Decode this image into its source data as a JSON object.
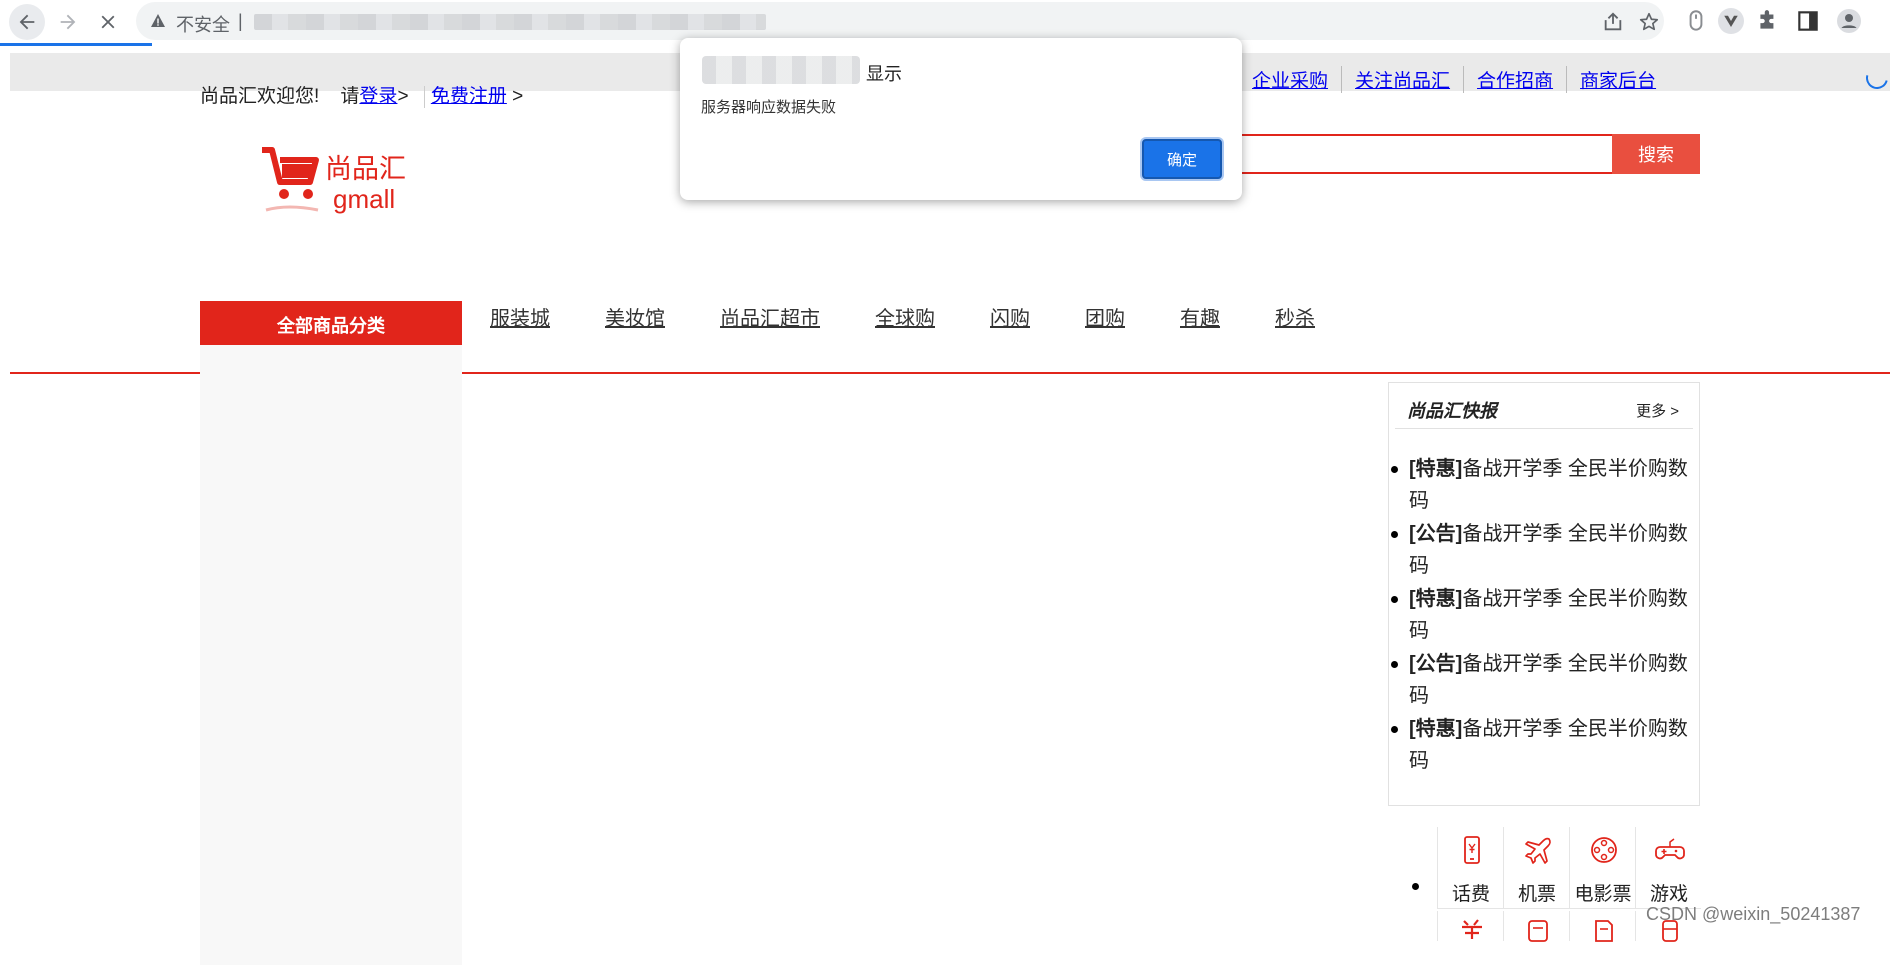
{
  "browser": {
    "security_label": "不安全",
    "separator": "|"
  },
  "topbar": {
    "welcome": "尚品汇欢迎您!",
    "login_prefix": "请",
    "login": "登录",
    "login_suffix": ">",
    "register": "免费注册",
    "register_suffix": ">",
    "links": [
      "企业采购",
      "关注尚品汇",
      "合作招商",
      "商家后台"
    ]
  },
  "logo": {
    "name": "尚品汇",
    "sub": "gmall"
  },
  "search": {
    "button": "搜索"
  },
  "nav": {
    "all_categories": "全部商品分类",
    "items": [
      "服装城",
      "美妆馆",
      "尚品汇超市",
      "全球购",
      "闪购",
      "团购",
      "有趣",
      "秒杀"
    ]
  },
  "news": {
    "title": "尚品汇快报",
    "more": "更多 >",
    "items": [
      {
        "tag": "[特惠]",
        "text": "备战开学季 全民半价购数码"
      },
      {
        "tag": "[公告]",
        "text": "备战开学季 全民半价购数码"
      },
      {
        "tag": "[特惠]",
        "text": "备战开学季 全民半价购数码"
      },
      {
        "tag": "[公告]",
        "text": "备战开学季 全民半价购数码"
      },
      {
        "tag": "[特惠]",
        "text": "备战开学季 全民半价购数码"
      }
    ]
  },
  "services": [
    {
      "label": "话费",
      "icon": "phone-icon"
    },
    {
      "label": "机票",
      "icon": "plane-icon"
    },
    {
      "label": "电影票",
      "icon": "film-icon"
    },
    {
      "label": "游戏",
      "icon": "gamepad-icon"
    }
  ],
  "dialog": {
    "title": "显示",
    "message": "服务器响应数据失败",
    "ok": "确定"
  },
  "watermark": "CSDN @weixin_50241387",
  "colors": {
    "brand_red": "#e1251b",
    "search_button": "#e94f3f",
    "chrome_blue": "#1a73e8"
  }
}
